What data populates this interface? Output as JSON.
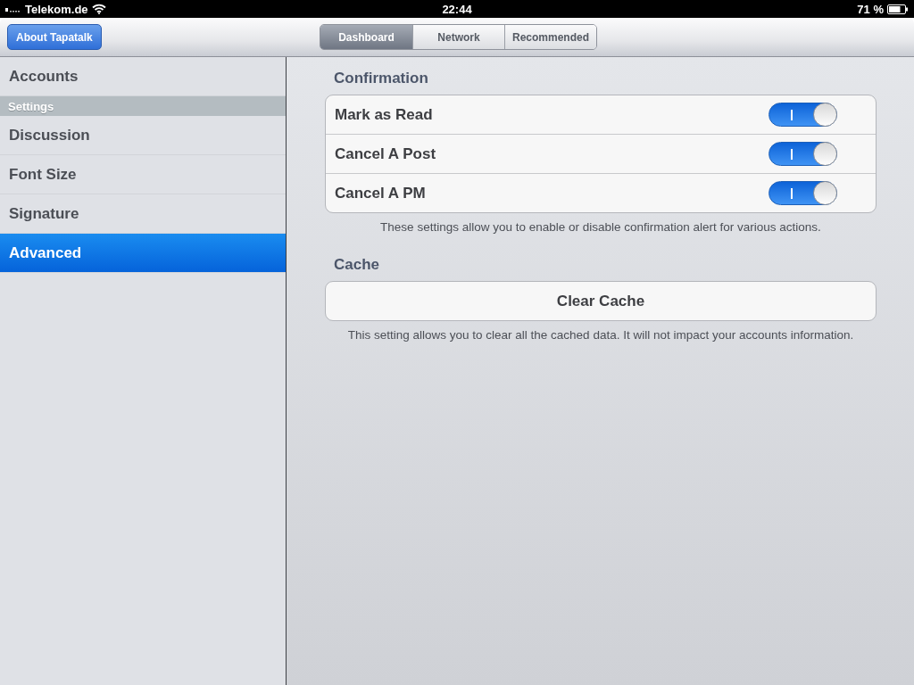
{
  "status_bar": {
    "carrier": "Telekom.de",
    "time": "22:44",
    "battery": "71 %"
  },
  "nav_bar": {
    "button": "About Tapatalk",
    "segments": [
      {
        "label": "Dashboard",
        "selected": true
      },
      {
        "label": "Network",
        "selected": false
      },
      {
        "label": "Recommended",
        "selected": false
      }
    ]
  },
  "sidebar": {
    "top_items": [
      {
        "label": "Accounts",
        "selected": false
      }
    ],
    "section_title": "Settings",
    "items": [
      {
        "label": "Discussion",
        "selected": false
      },
      {
        "label": "Font Size",
        "selected": false
      },
      {
        "label": "Signature",
        "selected": false
      },
      {
        "label": "Advanced",
        "selected": true
      }
    ]
  },
  "groups": [
    {
      "title": "Confirmation",
      "rows": [
        {
          "kind": "toggle",
          "label": "Mark as Read",
          "on": true
        },
        {
          "kind": "toggle",
          "label": "Cancel A Post",
          "on": true
        },
        {
          "kind": "toggle",
          "label": "Cancel A PM",
          "on": true
        }
      ],
      "footer": "These settings allow you to enable or disable confirmation alert for various actions."
    },
    {
      "title": "Cache",
      "rows": [
        {
          "kind": "button",
          "label": "Clear Cache"
        }
      ],
      "footer": "This setting allows you to clear all the cached data. It will not impact your accounts information."
    }
  ]
}
